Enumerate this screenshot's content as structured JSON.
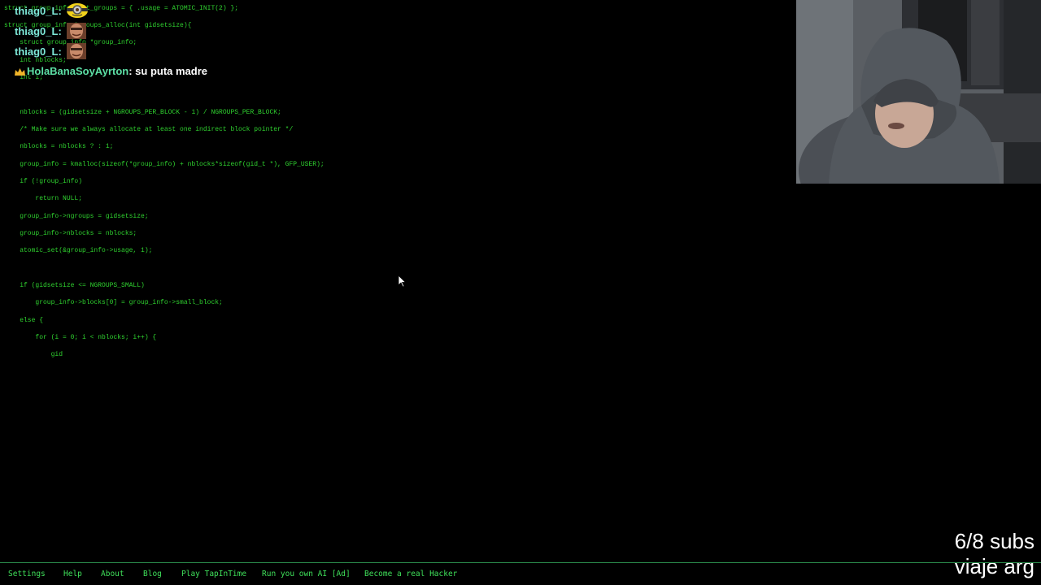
{
  "code": {
    "lines": [
      "struct group_info init_groups = { .usage = ATOMIC_INIT(2) };",
      "struct group_info *groups_alloc(int gidsetsize){",
      "    struct group_info *group_info;",
      "    int nblocks;",
      "    int i;",
      "",
      "",
      "    nblocks = (gidsetsize + NGROUPS_PER_BLOCK - 1) / NGROUPS_PER_BLOCK;",
      "    /* Make sure we always allocate at least one indirect block pointer */",
      "    nblocks = nblocks ? : 1;",
      "    group_info = kmalloc(sizeof(*group_info) + nblocks*sizeof(gid_t *), GFP_USER);",
      "    if (!group_info)",
      "        return NULL;",
      "    group_info->ngroups = gidsetsize;",
      "    group_info->nblocks = nblocks;",
      "    atomic_set(&group_info->usage, 1);",
      "",
      "    if (gidsetsize <= NGROUPS_SMALL)",
      "        group_info->blocks[0] = group_info->small_block;",
      "    else {",
      "        for (i = 0; i < nblocks; i++) {",
      "            gid"
    ]
  },
  "chat": {
    "messages": [
      {
        "user": "thiag0_L:",
        "text": "",
        "emote": "minion-emote"
      },
      {
        "user": "thiag0_L:",
        "text": "",
        "emote": "face-emote"
      },
      {
        "user": "thiag0_L:",
        "text": "",
        "emote": "face-emote"
      },
      {
        "user": "HolaBanaSoyAyrton",
        "text": ": su puta madre",
        "badge": "crown-icon"
      }
    ]
  },
  "subs": {
    "line1": "6/8 subs",
    "line2": "viaje arg"
  },
  "menu": {
    "items": [
      "Settings",
      "Help",
      "About",
      "Blog",
      "Play TapInTime",
      "Run you own AI [Ad]",
      "Become a real Hacker"
    ]
  },
  "colors": {
    "code": "#2fd12f",
    "menu": "#3fe05a",
    "background": "#000000"
  }
}
